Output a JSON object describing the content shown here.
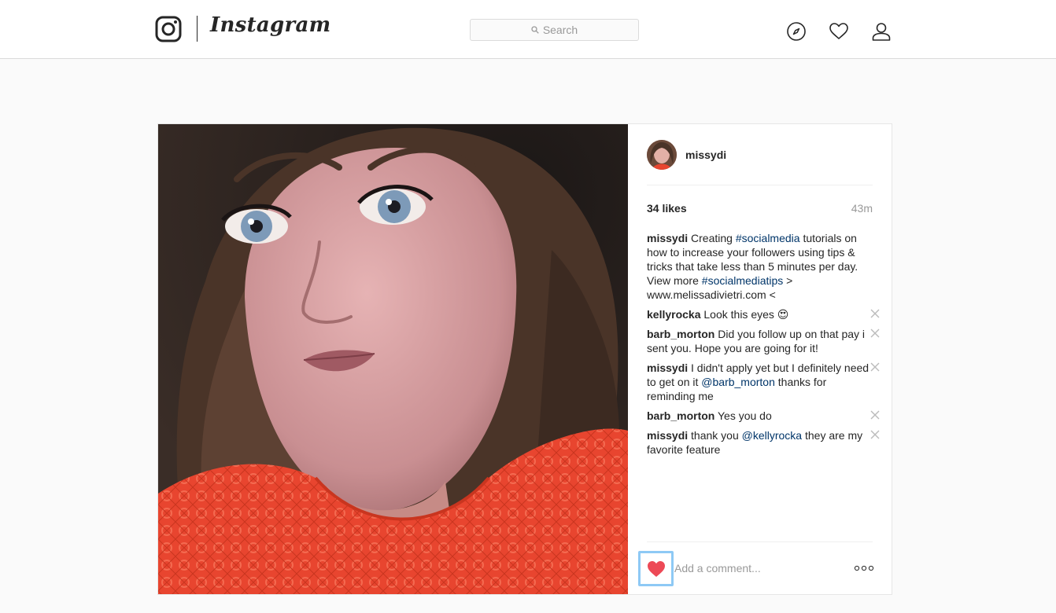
{
  "header": {
    "brand": "Instagram",
    "search_placeholder": "Search",
    "icons": [
      "instagram-camera-icon",
      "search-icon",
      "compass-icon",
      "heart-icon",
      "user-icon"
    ]
  },
  "post": {
    "owner": "missydi",
    "likes": "34 likes",
    "time": "43m",
    "caption": {
      "user": "missydi",
      "parts": [
        {
          "text": "Creating ",
          "tag": false
        },
        {
          "text": "#socialmedia",
          "tag": true
        },
        {
          "text": " tutorials on how to increase your followers using tips & tricks that take less than 5 minutes per day. View more ",
          "tag": false
        },
        {
          "text": "#socialmediatips",
          "tag": true
        },
        {
          "text": " > www.melissadivietri.com <",
          "tag": false
        }
      ]
    },
    "comments": [
      {
        "user": "kellyrocka",
        "parts": [
          {
            "text": "Look this eyes 😍",
            "tag": false
          }
        ]
      },
      {
        "user": "barb_morton",
        "parts": [
          {
            "text": "Did you follow up on that pay i sent you. Hope you are going for it!",
            "tag": false
          }
        ]
      },
      {
        "user": "missydi",
        "parts": [
          {
            "text": "I didn't apply yet but I definitely need to get on it ",
            "tag": false
          },
          {
            "text": "@barb_morton",
            "tag": true
          },
          {
            "text": " thanks for reminding me",
            "tag": false
          }
        ]
      },
      {
        "user": "barb_morton",
        "parts": [
          {
            "text": "Yes you do",
            "tag": false
          }
        ]
      },
      {
        "user": "missydi",
        "parts": [
          {
            "text": "thank you ",
            "tag": false
          },
          {
            "text": "@kellyrocka",
            "tag": true
          },
          {
            "text": " they are my favorite feature",
            "tag": false
          }
        ]
      }
    ],
    "add_comment_placeholder": "Add a comment...",
    "liked": true
  },
  "colors": {
    "like_red": "#ed4956",
    "link_blue": "#003569",
    "focus_ring": "#8ec9f5"
  }
}
